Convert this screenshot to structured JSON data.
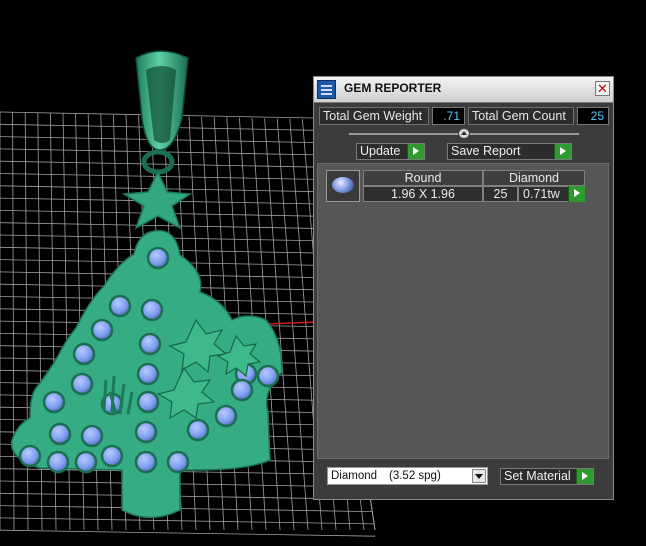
{
  "window": {
    "title": "GEM REPORTER",
    "close_label": "✕"
  },
  "stats": {
    "weight_label": "Total Gem Weight",
    "weight_value": ".71",
    "count_label": "Total Gem Count",
    "count_value": "25"
  },
  "buttons": {
    "update_label": "Update",
    "save_report_label": "Save Report",
    "set_material_label": "Set Material"
  },
  "gem_table": {
    "shape_header": "Round",
    "material_header": "Diamond",
    "rows": [
      {
        "thumbnail_icon": "round-gem-icon",
        "size": "1.96 X 1.96",
        "count": "25",
        "weight": "0.71tw"
      }
    ]
  },
  "material_select": {
    "value": "Diamond",
    "spg": "(3.52 spg)"
  },
  "colors": {
    "model": "#2fa07a",
    "gems": "#7f9ef0",
    "grid": "#cfcfcf",
    "accent_green": "#2f9a2f",
    "value_text": "#56c8ff"
  }
}
